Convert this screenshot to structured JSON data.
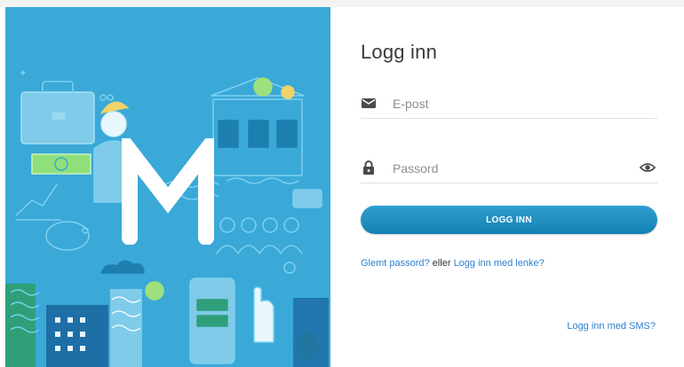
{
  "hero": {
    "logo_letter": "M",
    "background_color": "#3aa9d8"
  },
  "login": {
    "title": "Logg inn",
    "email": {
      "placeholder": "E-post",
      "value": "",
      "icon": "envelope-icon"
    },
    "password": {
      "placeholder": "Passord",
      "value": "",
      "icon": "lock-icon",
      "toggle_icon": "eye-icon"
    },
    "submit_label": "LOGG INN",
    "forgot_link": "Glemt passord?",
    "or_text": " eller ",
    "magic_link": "Logg inn med lenke?",
    "sms_link": "Logg inn med SMS?",
    "accent_color": "#1f93c8",
    "link_color": "#2a7fd0"
  }
}
